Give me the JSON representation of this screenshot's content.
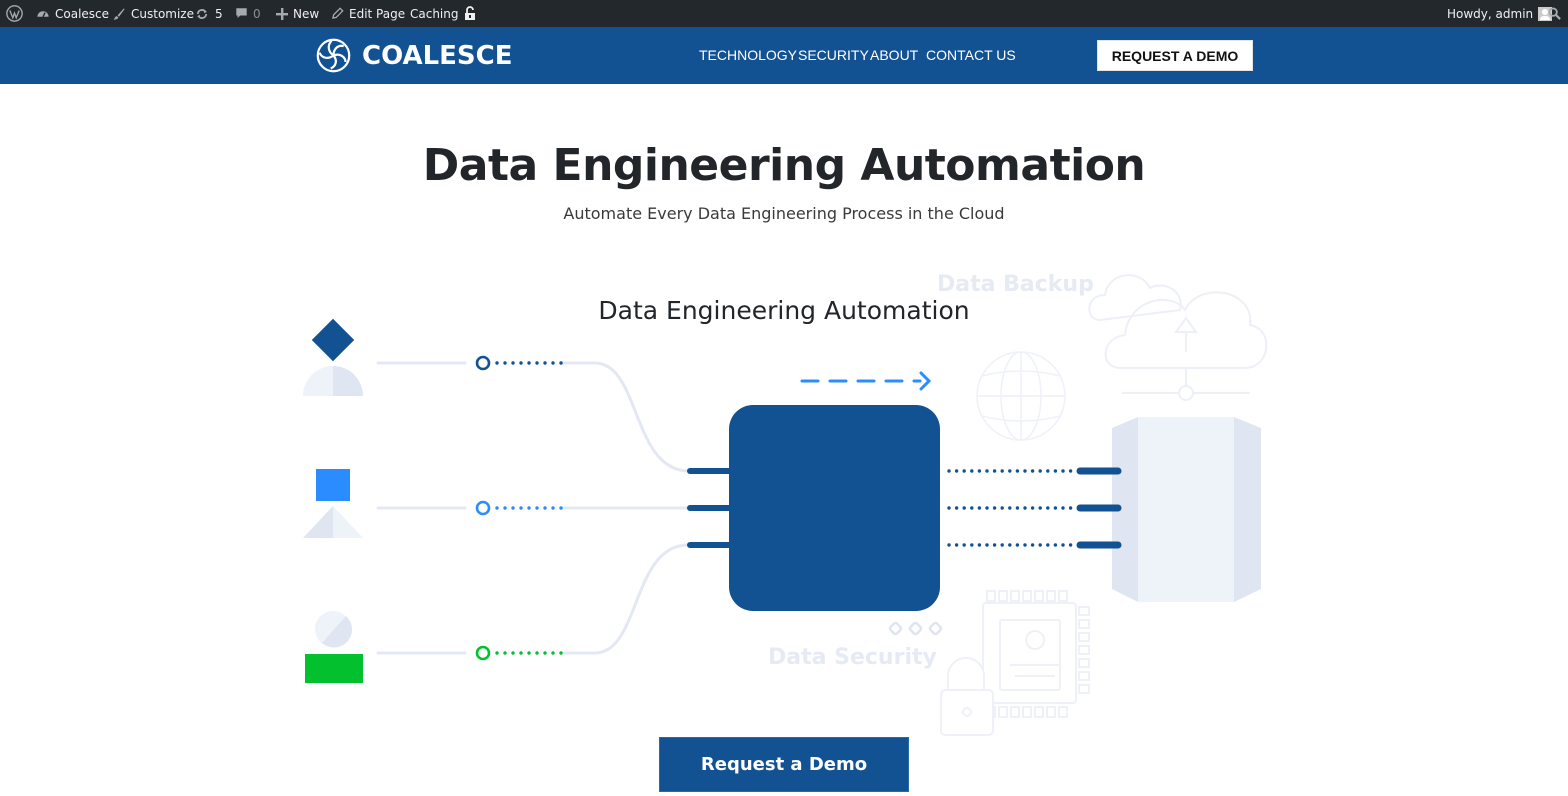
{
  "admin_bar": {
    "site_name": "Coalesce",
    "customize": "Customize",
    "updates_count": "5",
    "comments_count": "0",
    "new": "New",
    "edit_page": "Edit Page",
    "caching": "Caching",
    "greeting": "Howdy, admin"
  },
  "header": {
    "brand": "COALESCE",
    "nav": [
      "TECHNOLOGY",
      "SECURITY",
      "ABOUT",
      "CONTACT US"
    ],
    "cta": "REQUEST A DEMO"
  },
  "hero": {
    "title": "Data Engineering Automation",
    "subtitle": "Automate Every Data Engineering Process in the Cloud"
  },
  "diagram": {
    "title": "Data Engineering Automation",
    "backup_label": "Data Backup",
    "security_label": "Data Security",
    "colors": {
      "brand": "#135292",
      "accent_blue": "#2a8cff",
      "accent_green": "#03c12e",
      "faint": "#e3e8f2"
    }
  },
  "cta": {
    "label": "Request a Demo"
  }
}
